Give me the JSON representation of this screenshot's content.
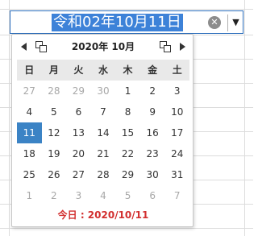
{
  "date_input": {
    "value": "令和02年10月11日",
    "clear_glyph": "✕",
    "dropdown_glyph": "▼"
  },
  "calendar": {
    "month_title": "2020年 10月",
    "weekdays": [
      "日",
      "月",
      "火",
      "水",
      "木",
      "金",
      "土"
    ],
    "weeks": [
      [
        "27",
        "28",
        "29",
        "30",
        "1",
        "2",
        "3"
      ],
      [
        "4",
        "5",
        "6",
        "7",
        "8",
        "9",
        "10"
      ],
      [
        "11",
        "12",
        "13",
        "14",
        "15",
        "16",
        "17"
      ],
      [
        "18",
        "19",
        "20",
        "21",
        "22",
        "23",
        "24"
      ],
      [
        "25",
        "26",
        "27",
        "28",
        "29",
        "30",
        "31"
      ],
      [
        "1",
        "2",
        "3",
        "4",
        "5",
        "6",
        "7"
      ]
    ],
    "selected_day": "11",
    "today_label": "今日 : 2020/10/11"
  },
  "colors": {
    "selection": "#3b83c5",
    "today_text": "#d22f2f",
    "input_border": "#2b6dbb"
  }
}
